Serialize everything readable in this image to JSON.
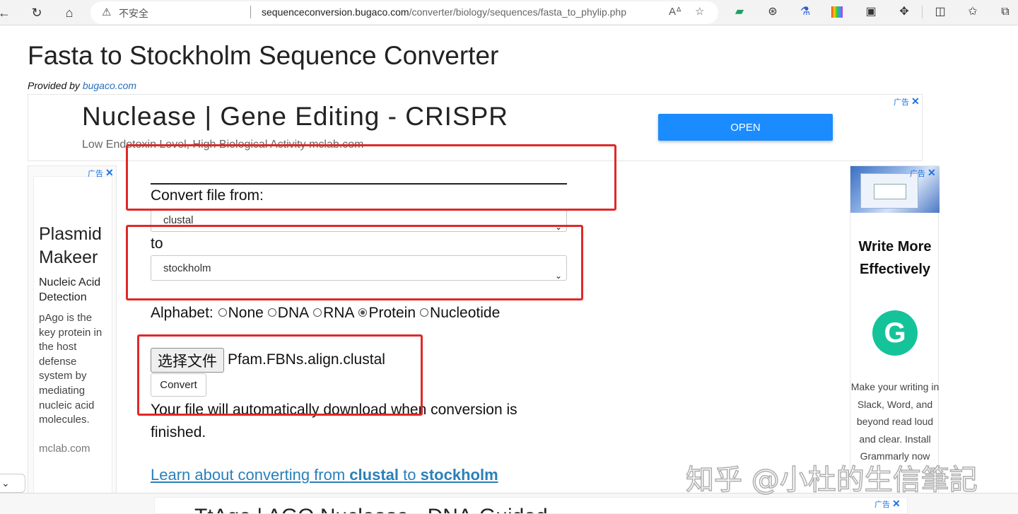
{
  "browser": {
    "security_label": "不安全",
    "url_host": "sequenceconversion.bugaco.com",
    "url_path": "/converter/biology/sequences/fasta_to_phylip.php",
    "icons": [
      "back-icon",
      "reload-icon",
      "home-icon",
      "warning-icon",
      "read-aloud-icon",
      "favorite-star-icon",
      "extension-icon",
      "collections-icon"
    ]
  },
  "page": {
    "title": "Fasta to Stockholm Sequence Converter",
    "provided_by": "Provided by",
    "provider_link": "bugaco.com"
  },
  "ad_top": {
    "headline": "Nuclease | Gene Editing - CRISPR",
    "subline": "Low Endotoxin Level, High Biological Activity mclab.com",
    "button": "OPEN",
    "ad_label": "广告",
    "close": "✕"
  },
  "ad_left": {
    "ad_label": "广告",
    "close": "✕",
    "headline": "Plasmid Makeer",
    "subhead": "Nucleic Acid Detection",
    "body": "pAgo is the key protein in the host defense system by mediating nucleic acid molecules.",
    "domain": "mclab.com"
  },
  "ad_right": {
    "ad_label": "广告",
    "close": "✕",
    "headline": "Write More Effectively",
    "logo": "G",
    "body": "Make your writing in Slack, Word, and beyond read loud and clear. Install Grammarly now"
  },
  "converter": {
    "from_label": "Convert file from:",
    "from_value": "clustal",
    "to_label": "to",
    "to_value": "stockholm",
    "alphabet_label": "Alphabet:",
    "alphabet_options": [
      {
        "label": "None",
        "selected": false
      },
      {
        "label": "DNA",
        "selected": false
      },
      {
        "label": "RNA",
        "selected": false
      },
      {
        "label": "Protein",
        "selected": true
      },
      {
        "label": "Nucleotide",
        "selected": false
      }
    ],
    "file_button": "选择文件",
    "file_name": "Pfam.FBNs.align.clustal",
    "convert_button": "Convert",
    "note": "Your file will automatically download when conversion is finished.",
    "learn_prefix": "Learn about converting from",
    "learn_from": "clustal",
    "learn_mid": "to",
    "learn_to": "stockholm"
  },
  "bottom_ad": {
    "ad_label": "广告",
    "close": "✕",
    "headline": "TtAgo | AGO Nuclease - DNA-Guided"
  },
  "watermark": "知乎 @小杜的生信筆記",
  "colors": {
    "link": "#2a80b9",
    "ad_button": "#1a8cff",
    "annotation": "#e02828",
    "grammarly": "#15c39a"
  }
}
